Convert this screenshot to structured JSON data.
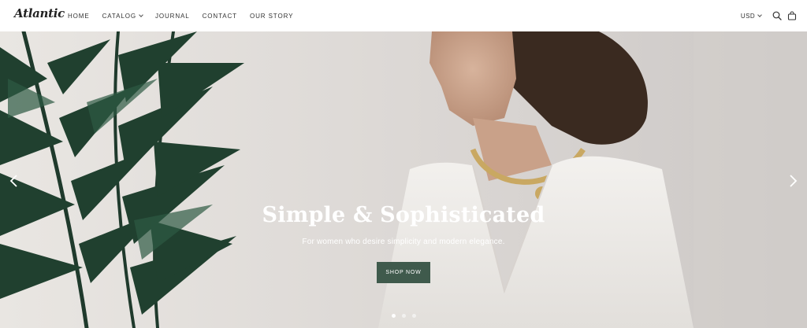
{
  "header": {
    "logo": "Atlantic",
    "nav": [
      {
        "label": "HOME",
        "dropdown": false
      },
      {
        "label": "CATALOG",
        "dropdown": true
      },
      {
        "label": "JOURNAL",
        "dropdown": false
      },
      {
        "label": "CONTACT",
        "dropdown": false
      },
      {
        "label": "OUR STORY",
        "dropdown": false
      }
    ],
    "currency": "USD",
    "icons": [
      "search-icon",
      "shopping-bag-icon"
    ]
  },
  "hero": {
    "title": "Simple & Sophisticated",
    "subtitle": "For women who desire simplicity and modern elegance.",
    "cta_label": "SHOP NOW",
    "slides": 3,
    "active_slide": 1,
    "colors": {
      "button": "#3f5a4c",
      "background": "#dedad6",
      "text": "#ffffff"
    }
  }
}
